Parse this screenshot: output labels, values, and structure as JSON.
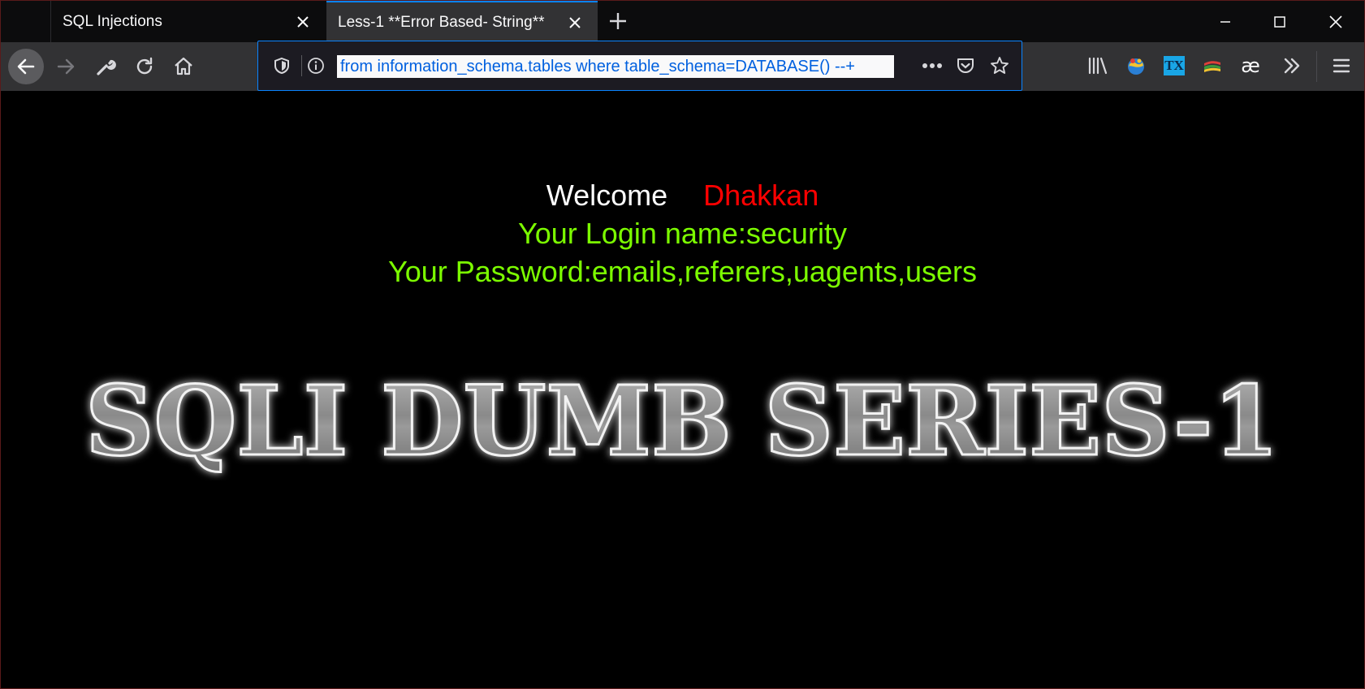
{
  "tabs": [
    {
      "title": "SQL Injections",
      "active": false
    },
    {
      "title": "Less-1 **Error Based- String**",
      "active": true
    }
  ],
  "urlbar": {
    "value": "from information_schema.tables where table_schema=DATABASE() --+"
  },
  "icons": {
    "back": "arrow-left-icon",
    "forward": "arrow-right-icon",
    "tools": "wrench-icon",
    "reload": "reload-icon",
    "home": "home-icon",
    "tracking": "shield-icon",
    "site_info": "info-icon",
    "page_actions": "more-dots-icon",
    "pocket": "pocket-icon",
    "bookmark": "star-icon",
    "library": "library-icon",
    "overflow": "chevron-double-right-icon",
    "menu": "hamburger-menu-icon"
  },
  "extension_labels": {
    "tx": "TX",
    "ae": "æ"
  },
  "page": {
    "welcome": "Welcome",
    "username": "Dhakkan",
    "login_line": "Your Login name:security",
    "password_line": "Your Password:emails,referers,uagents,users",
    "banner_text": "SQLI DUMB SERIES-1"
  },
  "colors": {
    "welcome": "#ffffff",
    "username": "#ff0000",
    "info": "#7cfc00",
    "background": "#000000",
    "accent": "#0a84ff"
  }
}
